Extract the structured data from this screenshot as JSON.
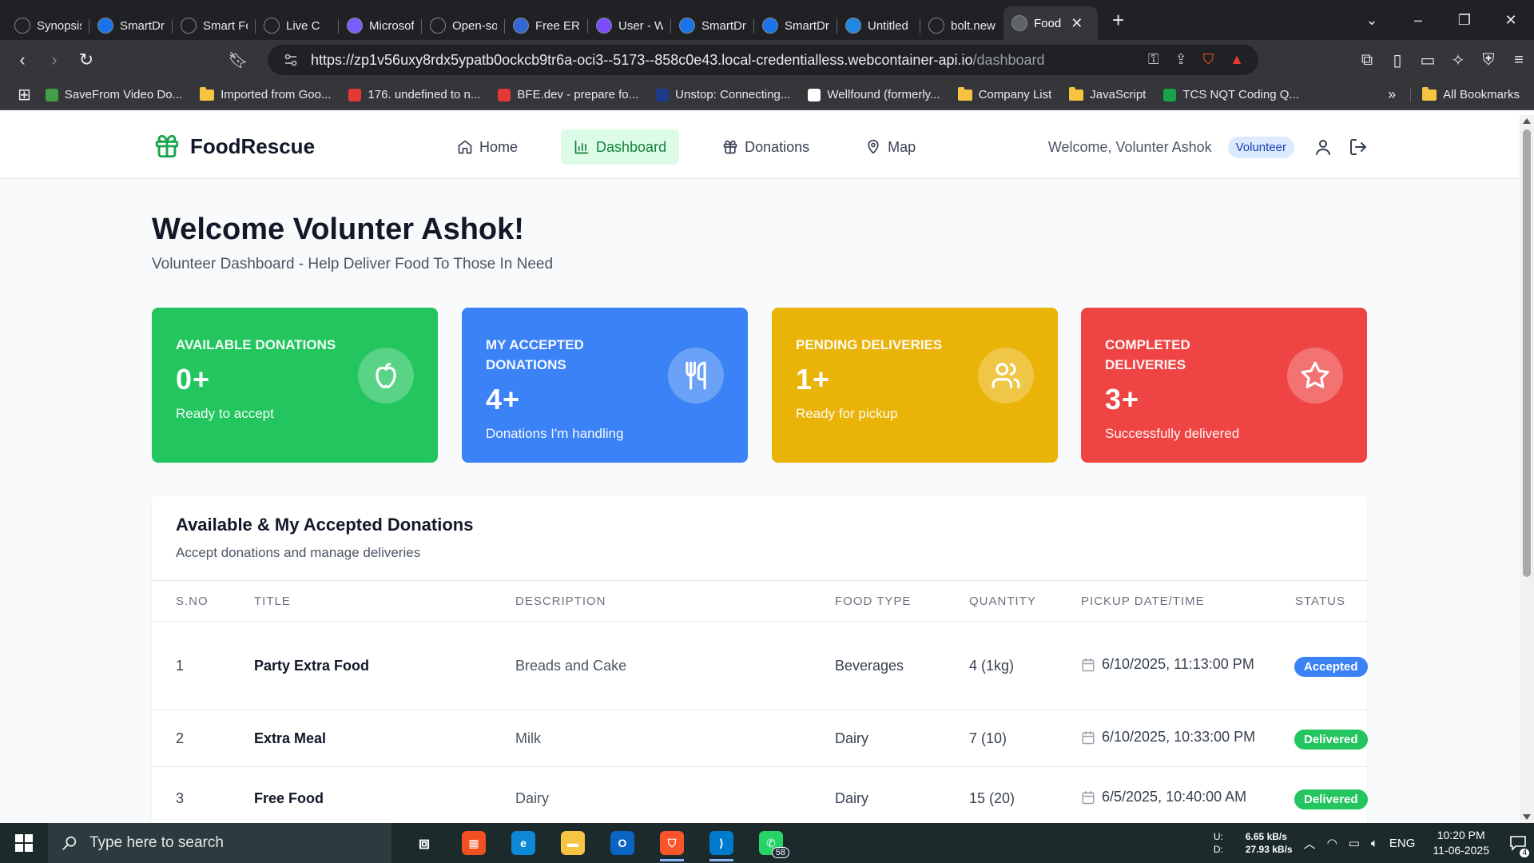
{
  "browser": {
    "tabs": [
      {
        "title": "Synopsis",
        "icon": "chatgpt-icon",
        "color": "#202124"
      },
      {
        "title": "SmartDra",
        "icon": "smartdraw-icon",
        "color": "#1a73e8"
      },
      {
        "title": "Smart Fo",
        "icon": "chatgpt-icon",
        "color": "#202124"
      },
      {
        "title": "Live C",
        "icon": "meet-icon",
        "color": "#202124"
      },
      {
        "title": "Microsoft",
        "icon": "copilot-icon",
        "color": "#7b5cff"
      },
      {
        "title": "Open-sou",
        "icon": "github-icon",
        "color": "#202124"
      },
      {
        "title": "Free ER D",
        "icon": "erd-icon",
        "color": "#3367d6"
      },
      {
        "title": "User - Wi",
        "icon": "app-icon",
        "color": "#7c4dff"
      },
      {
        "title": "SmartDra",
        "icon": "smartdraw-icon",
        "color": "#1a73e8"
      },
      {
        "title": "SmartDra",
        "icon": "smartdraw-icon",
        "color": "#1a73e8"
      },
      {
        "title": "Untitled",
        "icon": "diamond-icon",
        "color": "#1e88e5"
      },
      {
        "title": "bolt.new",
        "icon": "bolt-icon",
        "color": "#202124"
      },
      {
        "title": "Food",
        "icon": "globe-icon",
        "color": "#5f6368",
        "active": true
      }
    ],
    "url_main": "https://zp1v56uxy8rdx5ypatb0ockcb9tr6a-oci3--5173--858c0e43.local-credentialless.webcontainer-api.io",
    "url_path": "/dashboard",
    "bookmarks": [
      {
        "label": "SaveFrom Video Do...",
        "type": "icon",
        "color": "#43a047"
      },
      {
        "label": "Imported from Goo...",
        "type": "folder"
      },
      {
        "label": "176. undefined to n...",
        "type": "icon",
        "color": "#e53935",
        "mark": "BFE"
      },
      {
        "label": "BFE.dev - prepare fo...",
        "type": "icon",
        "color": "#e53935",
        "mark": "BFE"
      },
      {
        "label": "Unstop: Connecting...",
        "type": "icon",
        "color": "#1e3a8a",
        "mark": "un"
      },
      {
        "label": "Wellfound (formerly...",
        "type": "icon",
        "color": "#fff",
        "mark": "W:"
      },
      {
        "label": "Company List",
        "type": "folder"
      },
      {
        "label": "JavaScript",
        "type": "folder"
      },
      {
        "label": "TCS NQT Coding Q...",
        "type": "icon",
        "color": "#16a34a"
      }
    ],
    "bookmarks_more": "»",
    "all_bookmarks": "All Bookmarks"
  },
  "app": {
    "brand": "FoodRescue",
    "nav": [
      {
        "label": "Home",
        "icon": "home-icon"
      },
      {
        "label": "Dashboard",
        "icon": "bar-chart-icon",
        "active": true
      },
      {
        "label": "Donations",
        "icon": "gift-icon"
      },
      {
        "label": "Map",
        "icon": "map-pin-icon"
      }
    ],
    "welcome": "Welcome, Volunter Ashok",
    "role": "Volunteer"
  },
  "hero": {
    "title": "Welcome Volunter Ashok!",
    "subtitle": "Volunteer Dashboard - Help Deliver Food To Those In Need"
  },
  "stats": [
    {
      "label": "Available Donations",
      "value": "0+",
      "sub": "Ready to accept",
      "color": "#22c55e",
      "icon": "apple-icon"
    },
    {
      "label": "My Accepted Donations",
      "value": "4+",
      "sub": "Donations I'm handling",
      "color": "#3b82f6",
      "icon": "utensils-icon"
    },
    {
      "label": "Pending Deliveries",
      "value": "1+",
      "sub": "Ready for pickup",
      "color": "#eab308",
      "icon": "users-icon"
    },
    {
      "label": "Completed Deliveries",
      "value": "3+",
      "sub": "Successfully delivered",
      "color": "#ef4444",
      "icon": "star-icon"
    }
  ],
  "table": {
    "title": "Available & My Accepted Donations",
    "subtitle": "Accept donations and manage deliveries",
    "columns": [
      "S.No",
      "Title",
      "Description",
      "Food Type",
      "Quantity",
      "Pickup Date/Time",
      "Status"
    ],
    "rows": [
      {
        "sno": "1",
        "title": "Party Extra Food",
        "description": "Breads and Cake",
        "food_type": "Beverages",
        "quantity": "4 (1kg)",
        "pickup": "6/10/2025, 11:13:00 PM",
        "status": "Accepted",
        "status_color": "#3b82f6"
      },
      {
        "sno": "2",
        "title": "Extra Meal",
        "description": "Milk",
        "food_type": "Dairy",
        "quantity": "7 (10)",
        "pickup": "6/10/2025, 10:33:00 PM",
        "status": "Delivered",
        "status_color": "#22c55e"
      },
      {
        "sno": "3",
        "title": "Free Food",
        "description": "Dairy",
        "food_type": "Dairy",
        "quantity": "15 (20)",
        "pickup": "6/5/2025, 10:40:00 AM",
        "status": "Delivered",
        "status_color": "#22c55e"
      }
    ]
  },
  "taskbar": {
    "search_placeholder": "Type here to search",
    "apps": [
      {
        "name": "task-view-icon",
        "color": "transparent"
      },
      {
        "name": "microsoft-store-icon",
        "color": "#f25022"
      },
      {
        "name": "edge-icon",
        "color": "#0c88d6"
      },
      {
        "name": "file-explorer-icon",
        "color": "#f6c343"
      },
      {
        "name": "outlook-icon",
        "color": "#0a64c2"
      },
      {
        "name": "brave-icon",
        "color": "#fb542b",
        "active": true
      },
      {
        "name": "vscode-icon",
        "color": "#007acc",
        "active": true
      },
      {
        "name": "whatsapp-icon",
        "color": "#25d366",
        "badge": "58"
      }
    ],
    "net_up_label": "U:",
    "net_up": "6.65 kB/s",
    "net_down_label": "D:",
    "net_down": "27.93 kB/s",
    "language": "ENG",
    "time": "10:20 PM",
    "date": "11-06-2025",
    "notifications": "4"
  }
}
